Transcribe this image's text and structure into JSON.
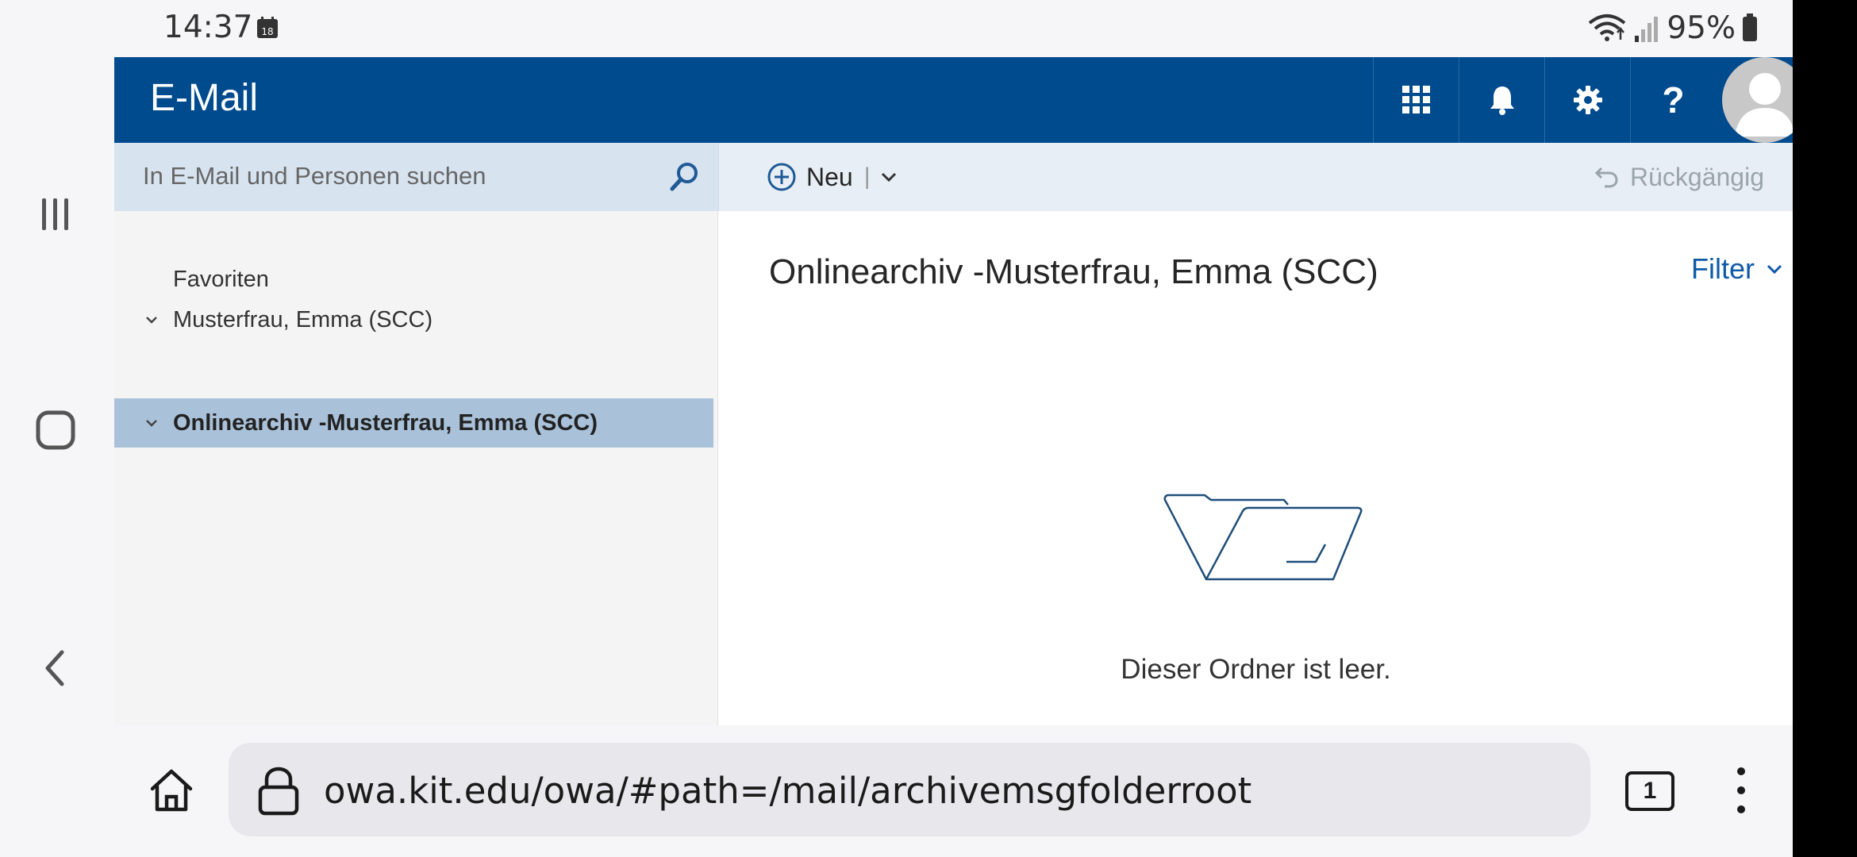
{
  "status_bar": {
    "time": "14:37",
    "calendar_day": "18",
    "battery_percent": "95%"
  },
  "header": {
    "title": "E-Mail",
    "help_label": "?"
  },
  "search": {
    "placeholder": "In E-Mail und Personen suchen"
  },
  "toolbar": {
    "new_label": "Neu",
    "separator": "|",
    "undo_label": "Rückgängig"
  },
  "folders": {
    "favorites_label": "Favoriten",
    "items": [
      {
        "label": "Musterfrau, Emma (SCC)",
        "selected": false
      },
      {
        "label": "Onlinearchiv -Musterfrau, Emma (SCC)",
        "selected": true
      }
    ]
  },
  "content": {
    "folder_title": "Onlinearchiv -Musterfrau, Emma (SCC)",
    "filter_label": "Filter",
    "empty_message": "Dieser Ordner ist leer."
  },
  "browser": {
    "url": "owa.kit.edu/owa/#path=/mail/archivemsgfolderroot",
    "tab_count": "1"
  },
  "colors": {
    "header_bg": "#004b8d",
    "selected_folder_bg": "#a9c1d9",
    "search_bg": "#d7e3ef",
    "accent_link": "#0f5aa8"
  }
}
